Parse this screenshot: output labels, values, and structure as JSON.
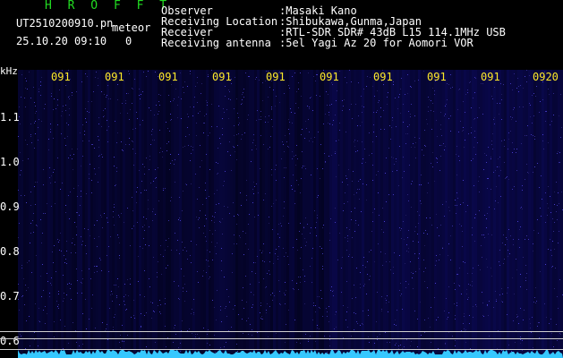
{
  "header": {
    "brand": "H R O F F T",
    "filename": "UT2510200910.pn",
    "tag": "meteor",
    "datetime": "25.10.20 09:10",
    "count": "0",
    "info": [
      {
        "label": "Observer",
        "value": ":Masaki Kano"
      },
      {
        "label": "Receiving Location",
        "value": ":Shibukawa,Gunma,Japan"
      },
      {
        "label": "Receiver",
        "value": ":RTL-SDR SDR# 43dB L15 114.1MHz USB"
      },
      {
        "label": "Receiving antenna",
        "value": ":5el Yagi Az 20 for Aomori VOR"
      }
    ]
  },
  "axis": {
    "y_unit": "kHz",
    "y_ticks": [
      "1.1",
      "1.0",
      "0.9",
      "0.8",
      "0.7",
      "0.6"
    ],
    "x_ticks": [
      "091",
      "091",
      "091",
      "091",
      "091",
      "091",
      "091",
      "091",
      "091",
      "0920"
    ]
  },
  "colors": {
    "brand": "#22dd22",
    "x_ticks": "#ffe92a",
    "background": "#000000",
    "spectrogram": "#04032c",
    "trace": "#36c8ff"
  }
}
